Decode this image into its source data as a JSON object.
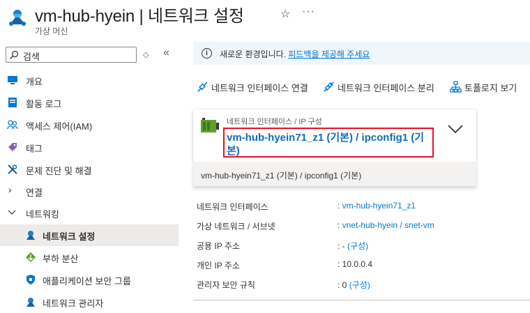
{
  "header": {
    "title": "vm-hub-hyein | 네트워크 설정",
    "subtitle": "가상 머신",
    "star_icon": "☆",
    "more_icon": "···"
  },
  "sidebar": {
    "search_placeholder": "검색",
    "items": [
      {
        "label": "개요",
        "icon": "monitor-icon"
      },
      {
        "label": "활동 로그",
        "icon": "log-icon"
      },
      {
        "label": "액세스 제어(IAM)",
        "icon": "people-icon"
      },
      {
        "label": "태그",
        "icon": "tag-icon"
      },
      {
        "label": "문제 진단 및 해결",
        "icon": "wrench-icon"
      },
      {
        "label": "연결",
        "icon": "chevron-right-icon"
      },
      {
        "label": "네트워킹",
        "icon": "chevron-down-icon"
      },
      {
        "label": "네트워크 설정",
        "icon": "network-icon",
        "active": true
      },
      {
        "label": "부하 분산",
        "icon": "load-balancer-icon"
      },
      {
        "label": "애플리케이션 보안 그룹",
        "icon": "shield-icon"
      },
      {
        "label": "네트워크 관리자",
        "icon": "network-manager-icon"
      }
    ]
  },
  "info": {
    "text": "새로운 환경입니다. ",
    "link": "피드백을 제공해 주세요"
  },
  "toolbar": {
    "attach": "네트워크 인터페이스 연결",
    "detach": "네트워크 인터페이스 분리",
    "topology": "토폴로지 보기"
  },
  "nic_selector": {
    "label": "네트워크 인터페이스 / IP 구성",
    "value": "vm-hub-hyein71_z1 (기본) / ipconfig1 (기본)",
    "option": "vm-hub-hyein71_z1 (기본) / ipconfig1 (기본)"
  },
  "properties": {
    "nic_key": "네트워크 인터페이스",
    "nic_value": "vm-hub-hyein71_z1",
    "vnet_key": "가상 네트워크 / 서브넷",
    "vnet_value": "vnet-hub-hyein / snet-vm",
    "public_ip_key": "공용 IP 주소",
    "public_ip_value": "- ",
    "public_ip_link": "(구성)",
    "private_ip_key": "개인 IP 주소",
    "private_ip_value": "10.0.0.4",
    "asr_key": "관리자 보안 규칙",
    "asr_value": "0 ",
    "asr_link": "(구성)"
  },
  "colors": {
    "accent": "#0078d4",
    "highlight_border": "#e81123",
    "info_bg": "#eff6fc",
    "active_nav_bg": "#edebe9"
  }
}
